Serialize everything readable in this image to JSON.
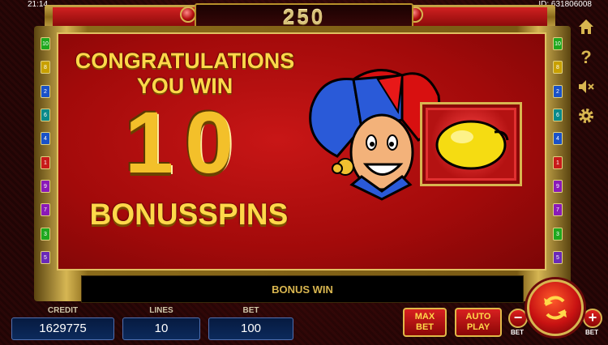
{
  "status": {
    "time": "21:14",
    "id": "ID: 631806008"
  },
  "header": {
    "total": "250"
  },
  "win": {
    "line1": "CONGRATULATIONS",
    "line2": "YOU WIN",
    "count": "10",
    "bonus_label": "BONUSSPINS"
  },
  "message": "BONUS WIN",
  "meters": {
    "credit_label": "CREDIT",
    "credit_value": "1629775",
    "lines_label": "LINES",
    "lines_value": "10",
    "bet_label": "BET",
    "bet_value": "100"
  },
  "buttons": {
    "max_line1": "MAX",
    "max_line2": "BET",
    "auto_line1": "AUTO",
    "auto_line2": "PLAY",
    "bet_minus": "−",
    "bet_plus": "+",
    "bet_minus_label": "BET",
    "bet_plus_label": "BET"
  },
  "line_markers_left": [
    "10",
    "8",
    "2",
    "6",
    "4",
    "1",
    "9",
    "7",
    "3",
    "5"
  ],
  "line_markers_right": [
    "10",
    "8",
    "2",
    "6",
    "4",
    "1",
    "9",
    "7",
    "3",
    "5"
  ],
  "marker_colors": [
    "#1fa81f",
    "#c8a000",
    "#1a52c8",
    "#0a8a8a",
    "#1a52c8",
    "#c81a1a",
    "#8a1ab8",
    "#8a1ab8",
    "#1fa81f",
    "#6a2ab8"
  ],
  "side_icons": [
    "home-icon",
    "help-icon",
    "sound-off-icon",
    "gear-icon"
  ],
  "symbol": "lemon-icon",
  "colors": {
    "accent_gold": "#ffd84a",
    "panel_red": "#c81616",
    "frame_gold": "#d6b653"
  }
}
